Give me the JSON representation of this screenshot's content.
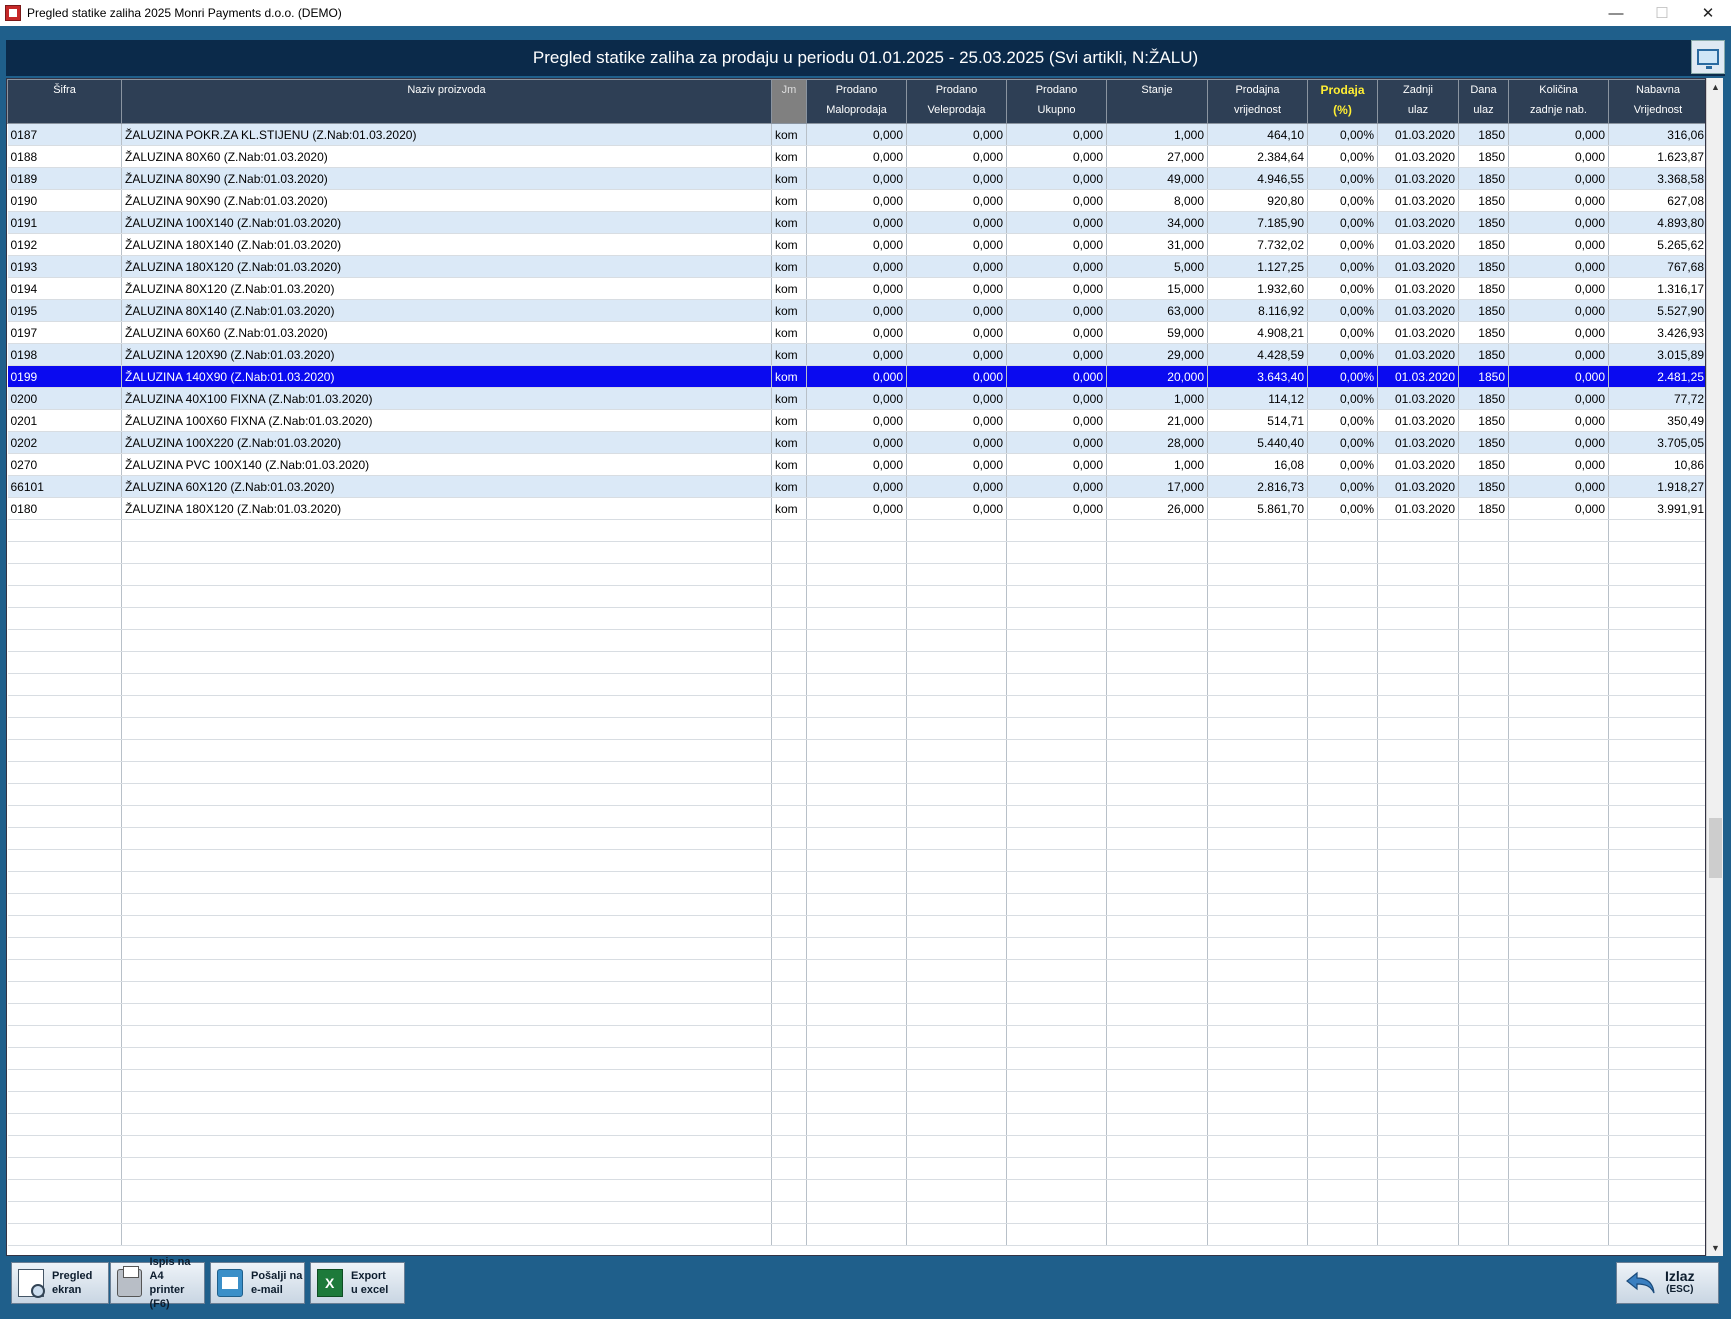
{
  "window": {
    "title": "Pregled statike zaliha 2025 Monri Payments d.o.o. (DEMO)",
    "minimize": "—",
    "maximize": "☐",
    "close": "✕"
  },
  "header": {
    "title": "Pregled statike zaliha za prodaju u periodu 01.01.2025 - 25.03.2025 (Svi artikli, N:ŽALU)",
    "icon": "monitor-icon"
  },
  "columns": [
    {
      "l1": "Šifra",
      "l2": ""
    },
    {
      "l1": "Naziv proizvoda",
      "l2": ""
    },
    {
      "l1": "Jm",
      "l2": ""
    },
    {
      "l1": "Prodano",
      "l2": "Maloprodaja"
    },
    {
      "l1": "Prodano",
      "l2": "Veleprodaja"
    },
    {
      "l1": "Prodano",
      "l2": "Ukupno"
    },
    {
      "l1": "Stanje",
      "l2": ""
    },
    {
      "l1": "Prodajna",
      "l2": "vrijednost"
    },
    {
      "l1": "Prodaja",
      "l2": "(%)"
    },
    {
      "l1": "Zadnji",
      "l2": "ulaz"
    },
    {
      "l1": "Dana",
      "l2": "ulaz"
    },
    {
      "l1": "Količina",
      "l2": "zadnje nab."
    },
    {
      "l1": "Nabavna",
      "l2": "Vrijednost"
    }
  ],
  "rows": [
    [
      "0187",
      "ŽALUZINA POKR.ZA KL.STIJENU   (Z.Nab:01.03.2020)",
      "kom",
      "0,000",
      "0,000",
      "0,000",
      "1,000",
      "464,10",
      "0,00%",
      "01.03.2020",
      "1850",
      "0,000",
      "316,06"
    ],
    [
      "0188",
      "ŽALUZINA 80X60   (Z.Nab:01.03.2020)",
      "kom",
      "0,000",
      "0,000",
      "0,000",
      "27,000",
      "2.384,64",
      "0,00%",
      "01.03.2020",
      "1850",
      "0,000",
      "1.623,87"
    ],
    [
      "0189",
      "ŽALUZINA 80X90   (Z.Nab:01.03.2020)",
      "kom",
      "0,000",
      "0,000",
      "0,000",
      "49,000",
      "4.946,55",
      "0,00%",
      "01.03.2020",
      "1850",
      "0,000",
      "3.368,58"
    ],
    [
      "0190",
      "ŽALUZINA 90X90   (Z.Nab:01.03.2020)",
      "kom",
      "0,000",
      "0,000",
      "0,000",
      "8,000",
      "920,80",
      "0,00%",
      "01.03.2020",
      "1850",
      "0,000",
      "627,08"
    ],
    [
      "0191",
      "ŽALUZINA 100X140   (Z.Nab:01.03.2020)",
      "kom",
      "0,000",
      "0,000",
      "0,000",
      "34,000",
      "7.185,90",
      "0,00%",
      "01.03.2020",
      "1850",
      "0,000",
      "4.893,80"
    ],
    [
      "0192",
      "ŽALUZINA 180X140   (Z.Nab:01.03.2020)",
      "kom",
      "0,000",
      "0,000",
      "0,000",
      "31,000",
      "7.732,02",
      "0,00%",
      "01.03.2020",
      "1850",
      "0,000",
      "5.265,62"
    ],
    [
      "0193",
      "ŽALUZINA 180X120   (Z.Nab:01.03.2020)",
      "kom",
      "0,000",
      "0,000",
      "0,000",
      "5,000",
      "1.127,25",
      "0,00%",
      "01.03.2020",
      "1850",
      "0,000",
      "767,68"
    ],
    [
      "0194",
      "ŽALUZINA 80X120   (Z.Nab:01.03.2020)",
      "kom",
      "0,000",
      "0,000",
      "0,000",
      "15,000",
      "1.932,60",
      "0,00%",
      "01.03.2020",
      "1850",
      "0,000",
      "1.316,17"
    ],
    [
      "0195",
      "ŽALUZINA 80X140   (Z.Nab:01.03.2020)",
      "kom",
      "0,000",
      "0,000",
      "0,000",
      "63,000",
      "8.116,92",
      "0,00%",
      "01.03.2020",
      "1850",
      "0,000",
      "5.527,90"
    ],
    [
      "0197",
      "ŽALUZINA 60X60   (Z.Nab:01.03.2020)",
      "kom",
      "0,000",
      "0,000",
      "0,000",
      "59,000",
      "4.908,21",
      "0,00%",
      "01.03.2020",
      "1850",
      "0,000",
      "3.426,93"
    ],
    [
      "0198",
      "ŽALUZINA 120X90   (Z.Nab:01.03.2020)",
      "kom",
      "0,000",
      "0,000",
      "0,000",
      "29,000",
      "4.428,59",
      "0,00%",
      "01.03.2020",
      "1850",
      "0,000",
      "3.015,89"
    ],
    [
      "0199",
      "ŽALUZINA 140X90   (Z.Nab:01.03.2020)",
      "kom",
      "0,000",
      "0,000",
      "0,000",
      "20,000",
      "3.643,40",
      "0,00%",
      "01.03.2020",
      "1850",
      "0,000",
      "2.481,25"
    ],
    [
      "0200",
      "ŽALUZINA 40X100 FIXNA   (Z.Nab:01.03.2020)",
      "kom",
      "0,000",
      "0,000",
      "0,000",
      "1,000",
      "114,12",
      "0,00%",
      "01.03.2020",
      "1850",
      "0,000",
      "77,72"
    ],
    [
      "0201",
      "ŽALUZINA 100X60 FIXNA   (Z.Nab:01.03.2020)",
      "kom",
      "0,000",
      "0,000",
      "0,000",
      "21,000",
      "514,71",
      "0,00%",
      "01.03.2020",
      "1850",
      "0,000",
      "350,49"
    ],
    [
      "0202",
      "ŽALUZINA 100X220   (Z.Nab:01.03.2020)",
      "kom",
      "0,000",
      "0,000",
      "0,000",
      "28,000",
      "5.440,40",
      "0,00%",
      "01.03.2020",
      "1850",
      "0,000",
      "3.705,05"
    ],
    [
      "0270",
      "ŽALUZINA PVC 100X140   (Z.Nab:01.03.2020)",
      "kom",
      "0,000",
      "0,000",
      "0,000",
      "1,000",
      "16,08",
      "0,00%",
      "01.03.2020",
      "1850",
      "0,000",
      "10,86"
    ],
    [
      "66101",
      "ŽALUZINA 60X120   (Z.Nab:01.03.2020)",
      "kom",
      "0,000",
      "0,000",
      "0,000",
      "17,000",
      "2.816,73",
      "0,00%",
      "01.03.2020",
      "1850",
      "0,000",
      "1.918,27"
    ],
    [
      "0180",
      "ŽALUZINA 180X120   (Z.Nab:01.03.2020)",
      "kom",
      "0,000",
      "0,000",
      "0,000",
      "26,000",
      "5.861,70",
      "0,00%",
      "01.03.2020",
      "1850",
      "0,000",
      "3.991,91"
    ]
  ],
  "selected_row_code": "0199",
  "footer": {
    "preview": {
      "l1": "Pregled",
      "l2": "ekran",
      "icon": "preview-icon"
    },
    "print": {
      "l1": "Ispis na A4",
      "l2": "printer (F6)",
      "icon": "printer-icon"
    },
    "email": {
      "l1": "Pošalji na",
      "l2": "e-mail",
      "icon": "mail-icon"
    },
    "excel": {
      "l1": "Export",
      "l2": "u excel",
      "icon": "excel-icon"
    },
    "exit": {
      "l1": "Izlaz",
      "l2": "(ESC)",
      "icon": "back-arrow-icon"
    }
  },
  "colors": {
    "header_bg": "#0b2a4a",
    "app_bg": "#1f5f8b",
    "row_alt": "#dbe9f7",
    "row_selected": "#0a0af0",
    "highlight_header": "#ffee33"
  }
}
